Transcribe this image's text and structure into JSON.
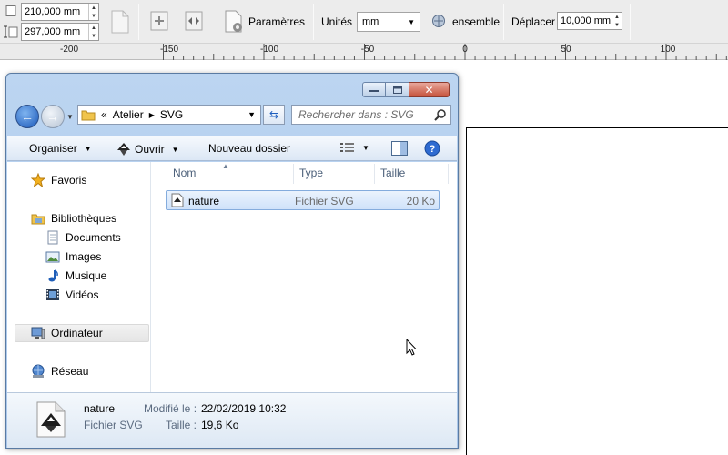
{
  "toolbar": {
    "width_value": "210,000 mm",
    "height_value": "297,000 mm",
    "params_label": "Paramètres",
    "units_label": "Unités",
    "units_value": "mm",
    "ensemble_label": "ensemble",
    "move_label": "Déplacer",
    "move_value": "10,000 mm"
  },
  "ruler": {
    "labels": [
      "-200",
      "-150",
      "-100",
      "-50",
      "0",
      "50",
      "100"
    ]
  },
  "dialog": {
    "breadcrumb_prefix": "«",
    "breadcrumb": [
      "Atelier",
      "SVG"
    ],
    "search_placeholder": "Rechercher dans : SVG",
    "commands": {
      "organize": "Organiser",
      "open": "Ouvrir",
      "new_folder": "Nouveau dossier"
    },
    "nav": {
      "favorites": "Favoris",
      "libraries": "Bibliothèques",
      "documents": "Documents",
      "images": "Images",
      "music": "Musique",
      "videos": "Vidéos",
      "computer": "Ordinateur",
      "network": "Réseau"
    },
    "columns": {
      "name": "Nom",
      "type": "Type",
      "size": "Taille"
    },
    "files": [
      {
        "name": "nature",
        "type": "Fichier SVG",
        "size": "20 Ko"
      }
    ],
    "details": {
      "name": "nature",
      "type": "Fichier SVG",
      "modified_label": "Modifié le :",
      "modified_value": "22/02/2019 10:32",
      "size_label": "Taille :",
      "size_value": "19,6 Ko"
    }
  },
  "colors": {
    "dialog_frame": "#bcd5f1",
    "selection": "#cfe2fa",
    "close_button": "#c6533c"
  }
}
